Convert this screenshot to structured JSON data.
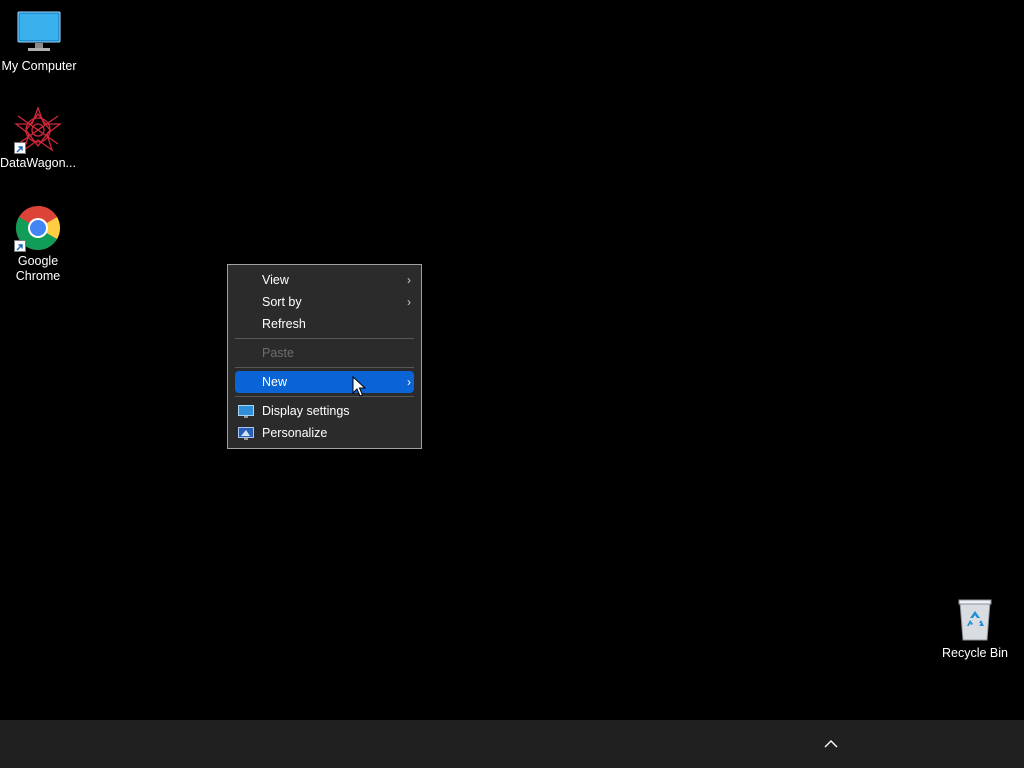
{
  "desktop": {
    "icons": [
      {
        "label": "My Computer",
        "icon": "monitor-icon"
      },
      {
        "label": "DataWagon...",
        "icon": "datawagon-icon",
        "shortcut": true
      },
      {
        "label": "Google Chrome",
        "icon": "chrome-icon",
        "shortcut": true
      },
      {
        "label": "Recycle Bin",
        "icon": "recycle-bin-icon"
      }
    ]
  },
  "context_menu": {
    "items": {
      "view": {
        "label": "View",
        "has_submenu": true
      },
      "sort_by": {
        "label": "Sort by",
        "has_submenu": true
      },
      "refresh": {
        "label": "Refresh"
      },
      "paste": {
        "label": "Paste",
        "disabled": true
      },
      "new": {
        "label": "New",
        "has_submenu": true,
        "highlighted": true
      },
      "display_settings": {
        "label": "Display settings",
        "icon": "display-settings-icon"
      },
      "personalize": {
        "label": "Personalize",
        "icon": "personalize-icon"
      }
    },
    "submenu_arrow": "›"
  },
  "colors": {
    "desktop_bg": "#000000",
    "menu_bg": "#2b2b2b",
    "highlight": "#0a64d6",
    "taskbar_bg": "#202020"
  },
  "taskbar": {
    "tray_icon": "chevron-up-icon"
  }
}
